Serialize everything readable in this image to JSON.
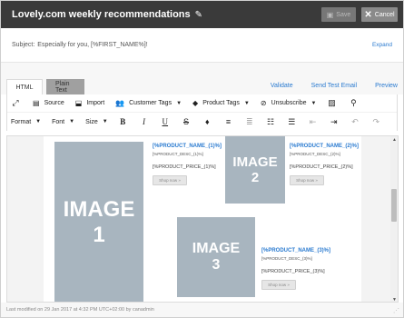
{
  "window": {
    "title": "Lovely.com weekly recommendations",
    "save_label": "Save",
    "cancel_label": "Cancel"
  },
  "subject": {
    "label": "Subject:",
    "value": "Especially for you, [%FIRST_NAME%]!",
    "expand_label": "Expand"
  },
  "tabs": [
    {
      "label": "HTML",
      "active": true
    },
    {
      "label": "Plain Text",
      "active": false
    }
  ],
  "tab_links": {
    "validate": "Validate",
    "send_test": "Send Test Email",
    "preview": "Preview"
  },
  "toolbar": {
    "source": "Source",
    "import": "Import",
    "customer_tags": "Customer Tags",
    "product_tags": "Product Tags",
    "unsubscribe": "Unsubscribe",
    "format": "Format",
    "font": "Font",
    "size": "Size"
  },
  "placeholders": [
    {
      "word": "IMAGE",
      "num": "1"
    },
    {
      "word": "IMAGE",
      "num": "2"
    },
    {
      "word": "IMAGE",
      "num": "3"
    }
  ],
  "products": [
    {
      "name": "[%PRODUCT_NAME_(1)%]",
      "desc": "[%PRODUCT_DESC_(1)%]",
      "price": "[%PRODUCT_PRICE_(1)%]",
      "button": "Shop now »"
    },
    {
      "name": "[%PRODUCT_NAME_(2)%]",
      "desc": "[%PRODUCT_DESC_(2)%]",
      "price": "[%PRODUCT_PRICE_(2)%]",
      "button": "Shop now »"
    },
    {
      "name": "[%PRODUCT_NAME_(3)%]",
      "desc": "[%PRODUCT_DESC_(3)%]",
      "price": "[%PRODUCT_PRICE_(3)%]",
      "button": "Shop now »"
    }
  ],
  "footer": {
    "text": "Last modified on 29 Jan 2017 at 4:32 PM UTC+02:00 by canadmin"
  },
  "colors": {
    "titlebar": "#3a3a3a",
    "link": "#2b7bd0",
    "placeholder": "#a8b5bf"
  }
}
